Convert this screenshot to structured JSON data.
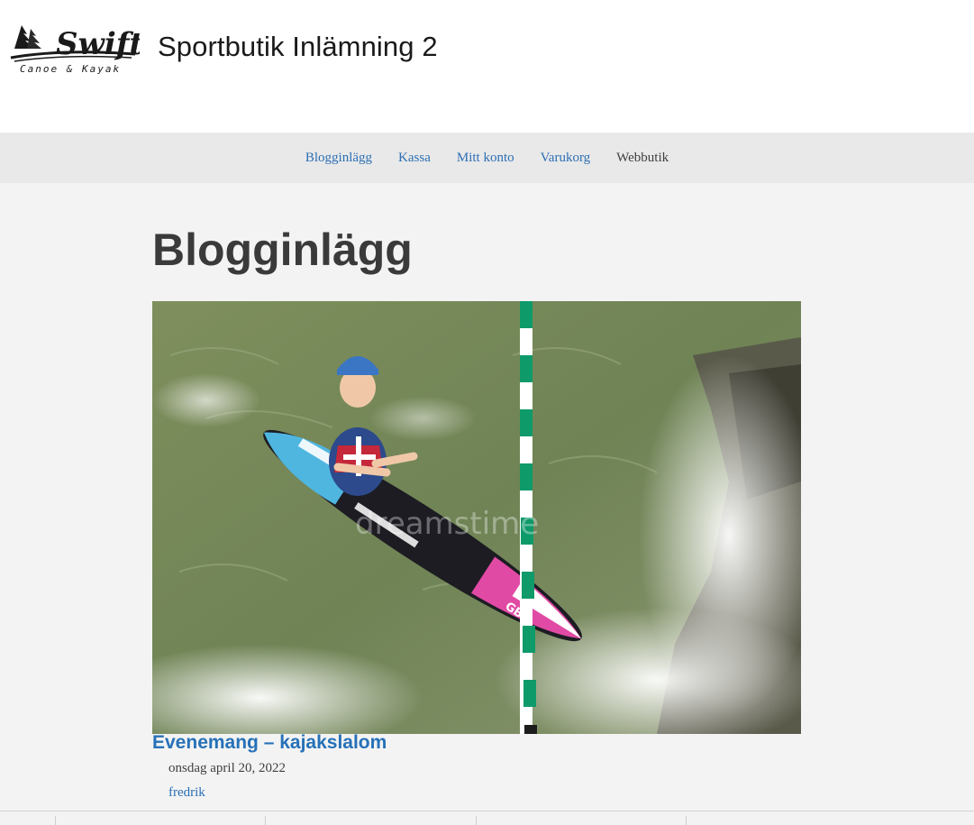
{
  "header": {
    "logo_text": "Swift",
    "logo_subtext": "Canoe & Kayak",
    "site_title": "Sportbutik Inlämning 2"
  },
  "nav": {
    "items": [
      {
        "label": "Blogginlägg",
        "current": false
      },
      {
        "label": "Kassa",
        "current": false
      },
      {
        "label": "Mitt konto",
        "current": false
      },
      {
        "label": "Varukorg",
        "current": false
      },
      {
        "label": "Webbutik",
        "current": true
      }
    ]
  },
  "main": {
    "page_title": "Blogginlägg",
    "post": {
      "title": "Evenemang – kajakslalom",
      "date": "onsdag april 20, 2022",
      "author": "fredrik",
      "image_watermark": "dreamstime",
      "kayak_label": "GBR"
    }
  },
  "colors": {
    "link": "#2c6fb4",
    "post_title": "#2671b8",
    "nav_bg": "#e9e9e9",
    "page_bg": "#f3f3f3"
  }
}
